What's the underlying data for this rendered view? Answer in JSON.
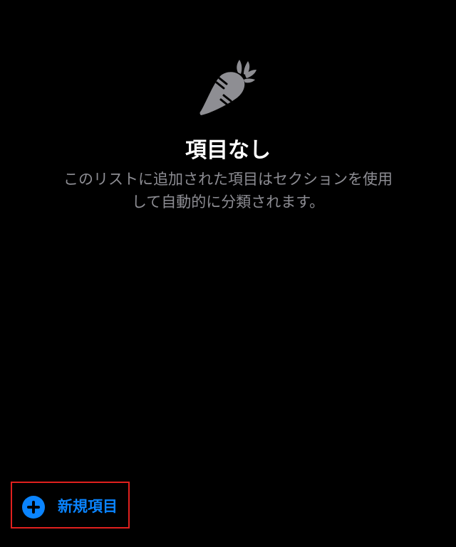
{
  "empty_state": {
    "icon": "carrot-icon",
    "title": "項目なし",
    "description_line1": "このリストに追加された項目はセクションを使用",
    "description_line2": "して自動的に分類されます。"
  },
  "footer": {
    "new_item_icon": "plus-circle-icon",
    "new_item_label": "新規項目"
  },
  "colors": {
    "background": "#000000",
    "accent": "#0a84ff",
    "secondary_text": "#8d8d93",
    "icon_gray": "#8e8e93",
    "highlight_border": "#e0201e"
  }
}
